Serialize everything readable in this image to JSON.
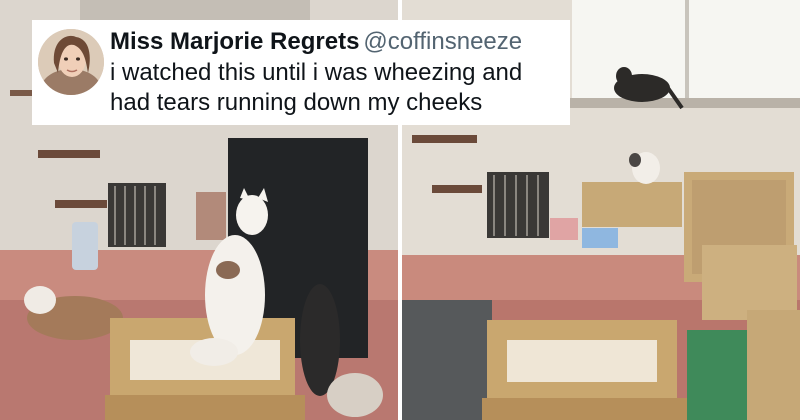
{
  "tweet": {
    "display_name": "Miss Marjorie Regrets",
    "handle": "@coffinsneeze",
    "text": "i watched this until i was wheezing and had tears running down my cheeks"
  },
  "colors": {
    "card_background": "#ffffff",
    "name_text": "#0f1419",
    "handle_text": "#536471"
  },
  "icons": {
    "avatar": "profile-photo"
  }
}
